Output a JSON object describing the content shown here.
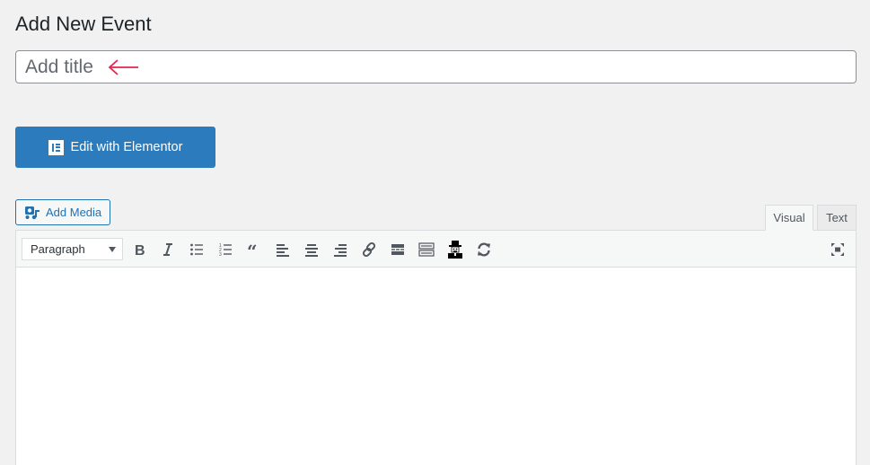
{
  "page": {
    "title": "Add New Event"
  },
  "title_field": {
    "placeholder": "Add title",
    "value": "",
    "annotation_arrow_color": "#e2264d"
  },
  "elementor": {
    "button_label": "Edit with Elementor",
    "icon": "elementor-icon",
    "color": "#2c7bbd"
  },
  "media": {
    "button_label": "Add Media",
    "icon": "media-icon"
  },
  "editor": {
    "tabs": [
      {
        "label": "Visual",
        "active": true
      },
      {
        "label": "Text",
        "active": false
      }
    ],
    "format_select": {
      "selected": "Paragraph"
    },
    "toolbar": [
      {
        "name": "bold",
        "icon": "bold-icon"
      },
      {
        "name": "italic",
        "icon": "italic-icon"
      },
      {
        "name": "bulleted-list",
        "icon": "bulleted-list-icon"
      },
      {
        "name": "numbered-list",
        "icon": "numbered-list-icon"
      },
      {
        "name": "blockquote",
        "icon": "blockquote-icon"
      },
      {
        "name": "align-left",
        "icon": "align-left-icon"
      },
      {
        "name": "align-center",
        "icon": "align-center-icon"
      },
      {
        "name": "align-right",
        "icon": "align-right-icon"
      },
      {
        "name": "insert-link",
        "icon": "link-icon"
      },
      {
        "name": "read-more",
        "icon": "read-more-icon"
      },
      {
        "name": "toolbar-toggle",
        "icon": "keyboard-icon"
      },
      {
        "name": "plugin-character",
        "icon": "hat-man-icon"
      },
      {
        "name": "refresh",
        "icon": "refresh-icon"
      },
      {
        "name": "fullscreen",
        "icon": "fullscreen-icon"
      }
    ],
    "content": ""
  }
}
